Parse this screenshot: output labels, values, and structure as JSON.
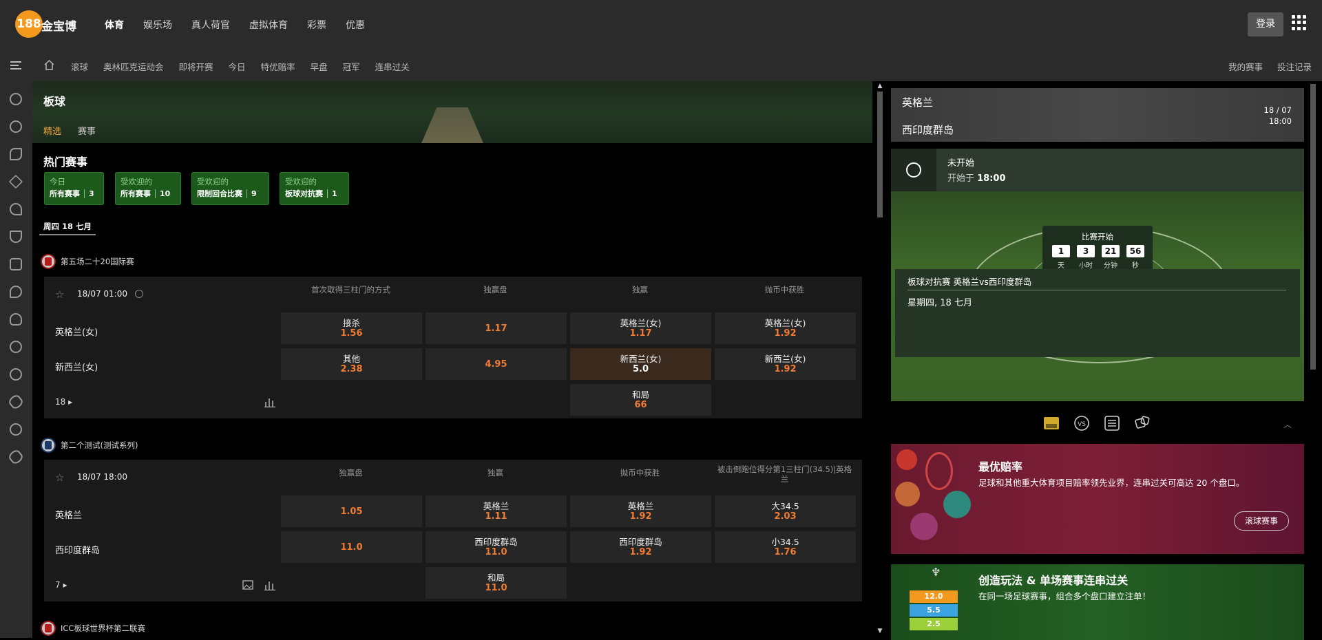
{
  "header": {
    "logo_text": "188金宝博",
    "logo_badge": "188",
    "logo_suffix": "金宝博",
    "nav": [
      "体育",
      "娱乐场",
      "真人荷官",
      "虚拟体育",
      "彩票",
      "优惠"
    ],
    "login_label": "登录"
  },
  "subnav": {
    "items": [
      "滚球",
      "奥林匹克运动会",
      "即将开赛",
      "今日",
      "特优赔率",
      "早盘",
      "冠军",
      "连串过关"
    ],
    "right": [
      "我的赛事",
      "投注记录"
    ]
  },
  "sidebar_icons": [
    "soccer-icon",
    "basketball-icon",
    "tennis-icon",
    "cricket-icon",
    "badminton-icon",
    "trophy-icon",
    "swimming-icon",
    "table-tennis-icon",
    "boxing-icon",
    "esports-icon",
    "volleyball-icon",
    "rugby-icon",
    "darts-icon",
    "football-icon"
  ],
  "hero": {
    "title": "板球",
    "tabs": [
      "精选",
      "赛事"
    ]
  },
  "hot": {
    "title": "热门赛事",
    "cards": [
      {
        "l1": "今日",
        "l2": "所有赛事",
        "count": "3"
      },
      {
        "l1": "受欢迎的",
        "l2": "所有赛事",
        "count": "10"
      },
      {
        "l1": "受欢迎的",
        "l2": "限制回合比赛",
        "count": "9"
      },
      {
        "l1": "受欢迎的",
        "l2": "板球对抗赛",
        "count": "1"
      }
    ]
  },
  "date_tab": "周四 18 七月",
  "leagues": [
    {
      "name": "第五场二十20国际赛",
      "time": "18/07 01:00",
      "columns": [
        "首次取得三柱门的方式",
        "独赢盘",
        "独赢",
        "抛币中获胜"
      ],
      "teams": [
        "英格兰(女)",
        "新西兰(女)"
      ],
      "rows": [
        [
          {
            "t": "接杀",
            "o": "1.56"
          },
          {
            "t": "",
            "o": "1.17"
          },
          {
            "t": "英格兰(女)",
            "o": "1.17"
          },
          {
            "t": "英格兰(女)",
            "o": "1.92"
          }
        ],
        [
          {
            "t": "其他",
            "o": "2.38"
          },
          {
            "t": "",
            "o": "4.95"
          },
          {
            "t": "新西兰(女)",
            "o": "5.0"
          },
          {
            "t": "新西兰(女)",
            "o": "1.92"
          }
        ]
      ],
      "draw": {
        "t": "和局",
        "o": "66"
      },
      "more": "18"
    },
    {
      "name": "第二个测试(测试系列)",
      "time": "18/07 18:00",
      "columns": [
        "独赢盘",
        "独赢",
        "抛币中获胜",
        "被击倒跑位得分第1三柱门(34.5)|英格兰"
      ],
      "teams": [
        "英格兰",
        "西印度群岛"
      ],
      "rows": [
        [
          {
            "t": "",
            "o": "1.05"
          },
          {
            "t": "英格兰",
            "o": "1.11"
          },
          {
            "t": "英格兰",
            "o": "1.92"
          },
          {
            "t": "大34.5",
            "o": "2.03"
          }
        ],
        [
          {
            "t": "",
            "o": "11.0"
          },
          {
            "t": "西印度群岛",
            "o": "11.0"
          },
          {
            "t": "西印度群岛",
            "o": "1.92"
          },
          {
            "t": "小34.5",
            "o": "1.76"
          }
        ]
      ],
      "draw": {
        "t": "和局",
        "o": "11.0"
      },
      "more": "7"
    },
    {
      "name": "ICC板球世界杯第二联赛"
    }
  ],
  "match_panel": {
    "team1": "英格兰",
    "team2": "西印度群岛",
    "date": "18 / 07",
    "time": "18:00",
    "status": "未开始",
    "start_prefix": "开始于 ",
    "start_time": "18:00",
    "countdown_title": "比赛开始",
    "countdown": [
      {
        "n": "1",
        "u": "天"
      },
      {
        "n": "3",
        "u": "小时"
      },
      {
        "n": "21",
        "u": "分钟"
      },
      {
        "n": "56",
        "u": "秒"
      }
    ],
    "info_title": "板球对抗赛 英格兰vs西印度群岛",
    "info_date": "星期四, 18 七月"
  },
  "promo1": {
    "title": "最优赔率",
    "desc": "足球和其他重大体育项目赔率领先业界，连串过关可高达 20 个盘口。",
    "button": "滚球赛事"
  },
  "promo2": {
    "title": "创造玩法 & 单场赛事连串过关",
    "desc": "在同一场足球赛事，组合多个盘口建立注单！",
    "odds": [
      "12.0",
      "5.5",
      "2.5"
    ]
  },
  "colors": {
    "accent": "#f07d33",
    "active_tab": "#f2a23a",
    "hot_card": "#1b5a1b",
    "selected_cell": "#3a2a1d"
  }
}
